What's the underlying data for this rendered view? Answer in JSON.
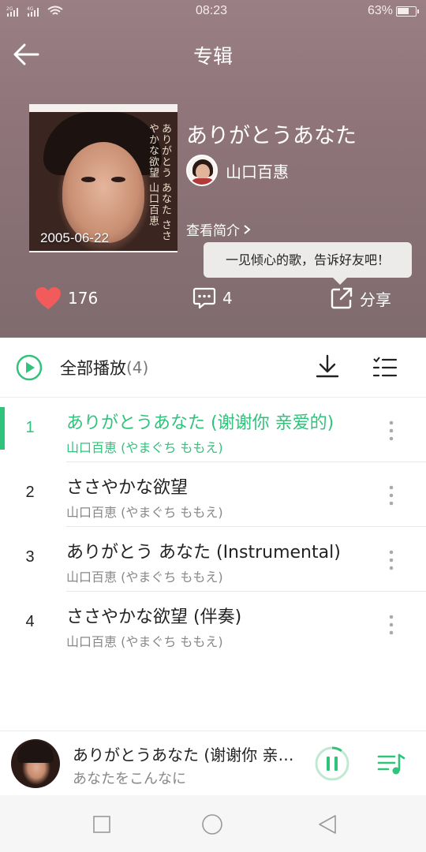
{
  "status": {
    "network_left": "2G",
    "network_right": "4G",
    "time": "08:23",
    "battery": "63%",
    "battery_level": 0.63
  },
  "header": {
    "title": "专辑",
    "back_icon": "arrow-left-icon"
  },
  "album": {
    "name": "ありがとうあなた",
    "artist": "山口百惠",
    "release_date": "2005-06-22",
    "intro_label": "查看简介",
    "cover_text": "ありがとう あなた ささやかな欲望 山口百恵"
  },
  "tooltip": {
    "text": "一见倾心的歌，告诉好友吧！"
  },
  "actions": {
    "like_count": "176",
    "comment_count": "4",
    "share_label": "分享"
  },
  "play_all": {
    "label": "全部播放",
    "count": "(4)"
  },
  "tracks": [
    {
      "index": "1",
      "title": "ありがとうあなた (谢谢你 亲爱的)",
      "artist": "山口百恵 (やまぐち ももえ)",
      "playing": true
    },
    {
      "index": "2",
      "title": "ささやかな欲望",
      "artist": "山口百恵 (やまぐち ももえ)",
      "playing": false
    },
    {
      "index": "3",
      "title": "ありがとう あなた (Instrumental)",
      "artist": "山口百恵 (やまぐち ももえ)",
      "playing": false
    },
    {
      "index": "4",
      "title": "ささやかな欲望 (伴奏)",
      "artist": "山口百恵 (やまぐち ももえ)",
      "playing": false
    }
  ],
  "player": {
    "title": "ありがとうあなた (谢谢你 亲爱的)",
    "lyric": "あなたをこんなに",
    "progress": 0.1
  },
  "colors": {
    "accent": "#31c27c",
    "like": "#f25b5b",
    "header_bg": "#8e7479"
  }
}
